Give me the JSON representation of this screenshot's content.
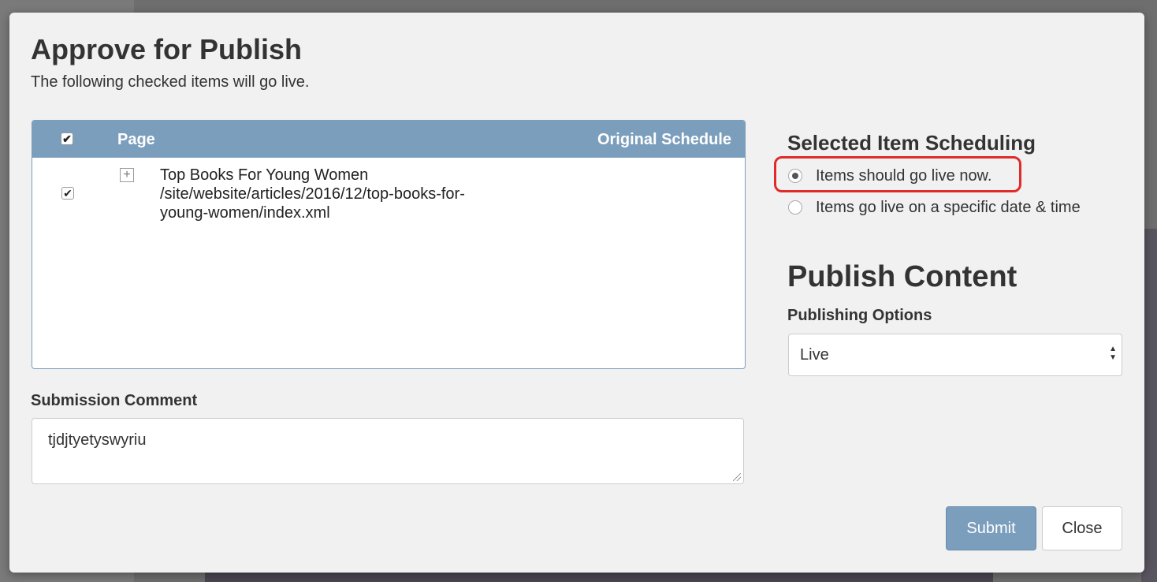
{
  "dialog": {
    "title": "Approve for Publish",
    "subtitle": "The following checked items will go live."
  },
  "table": {
    "col_page": "Page",
    "col_schedule": "Original Schedule",
    "rows": [
      {
        "title": "Top Books For Young Women",
        "path_line1": "/site/website/articles/2016/12/top-books-for-",
        "path_line2": "young-women/index.xml",
        "checked": true
      }
    ]
  },
  "comment": {
    "label": "Submission Comment",
    "value": "tjdjtyetyswyriu"
  },
  "scheduling": {
    "title": "Selected Item Scheduling",
    "option_now": "Items should go live now.",
    "option_date": "Items go live on a specific date & time",
    "selected": "now"
  },
  "publish": {
    "title": "Publish Content",
    "options_label": "Publishing Options",
    "selected_option": "Live"
  },
  "buttons": {
    "submit": "Submit",
    "close": "Close"
  },
  "colors": {
    "accent": "#7b9ebd",
    "highlight": "#e12a2a"
  },
  "icons": {
    "checkbox": "checkmark-icon",
    "expand": "plus-icon",
    "select": "up-down-arrows-icon"
  }
}
